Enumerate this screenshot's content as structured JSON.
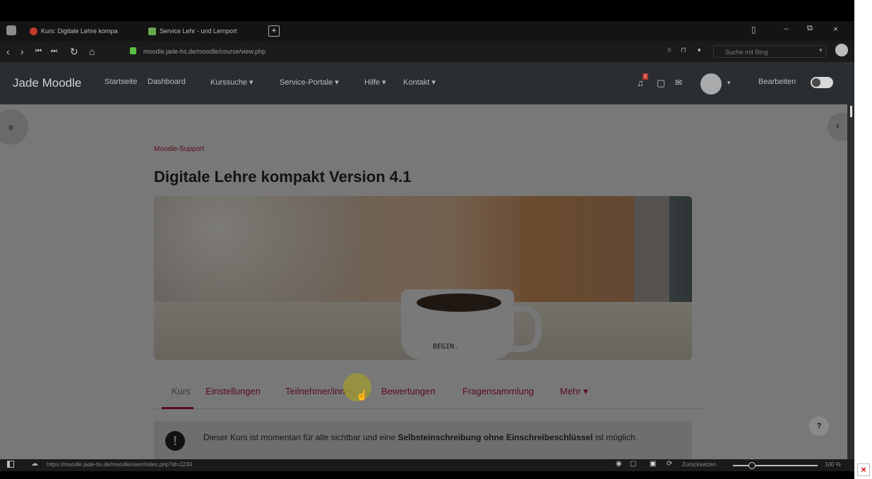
{
  "browser": {
    "tabs": [
      {
        "label": "Kurs: Digitale Lehre kompa"
      },
      {
        "label": "Service Lehr - und Lernport"
      }
    ],
    "url": "moodle.jade-hs.de/moodle/course/view.php",
    "search_placeholder": "Suche mit Bing",
    "status_url": "https://moodle.jade-hs.de/moodle/user/index.php?id=1234",
    "status_right": "Zurücksetzen",
    "zoom": "100 %"
  },
  "moodle": {
    "brand": "Jade Moodle",
    "nav": [
      "Startseite",
      "Dashboard",
      "Kurssuche ▾",
      "Service-Portale ▾",
      "Hilfe ▾",
      "Kontakt ▾"
    ],
    "edit_label": "Bearbeiten",
    "notification_count": "1"
  },
  "course": {
    "breadcrumb": "Moodle-Support",
    "title": "Digitale Lehre kompakt Version 4.1",
    "image_caption": "BEGIN.",
    "tabs": [
      {
        "label": "Kurs"
      },
      {
        "label": "Einstellungen"
      },
      {
        "label": "Teilnehmer/innen"
      },
      {
        "label": "Bewertungen"
      },
      {
        "label": "Fragensammlung"
      },
      {
        "label": "Mehr ▾"
      }
    ],
    "notice_text": "Dieser Kurs ist momentan für alle sichtbar und eine ",
    "notice_bold": "Selbsteinschreibung ohne Einschreibeschlüssel",
    "notice_end": " ist möglich."
  },
  "help_label": "?",
  "colors": {
    "accent": "#b5193f",
    "header": "#2a2e31",
    "content_dim": "#787878"
  }
}
